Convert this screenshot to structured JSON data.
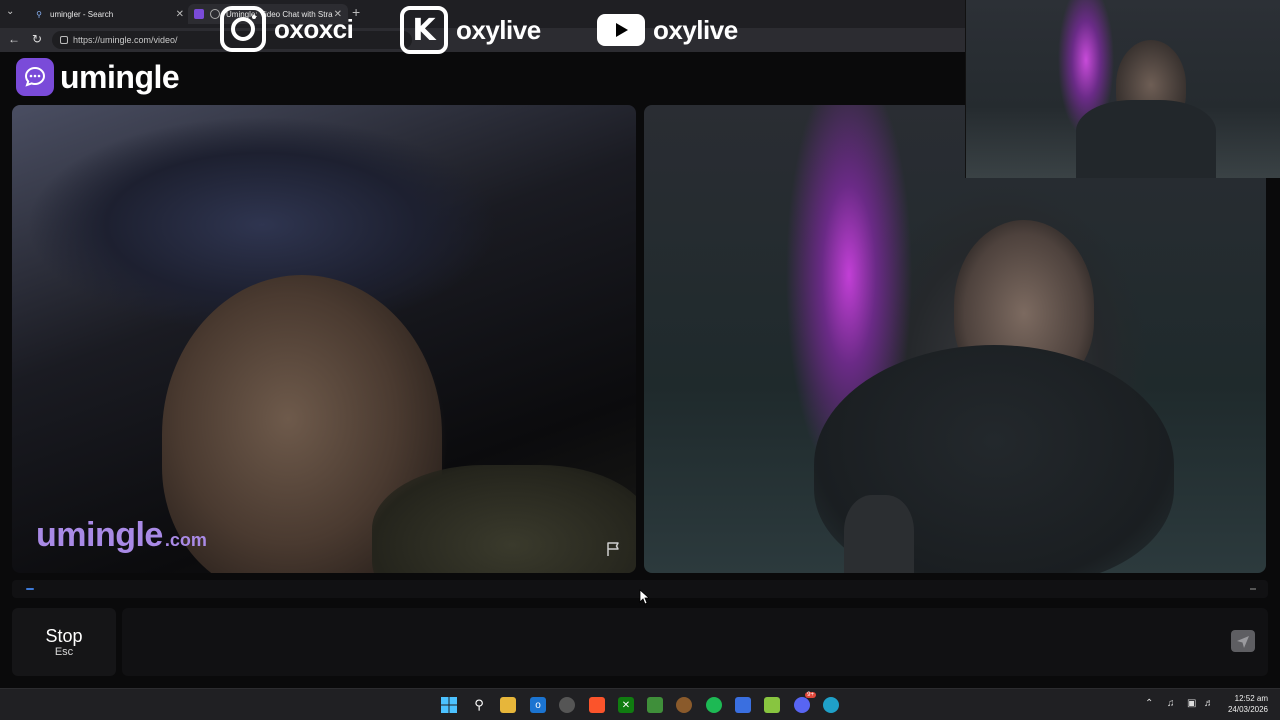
{
  "browser": {
    "tabs": [
      {
        "label": "umingler - Search",
        "active": false
      },
      {
        "label": "Umingle: Video Chat with Stra",
        "active": true
      }
    ],
    "url": "https://umingle.com/video/"
  },
  "overlay": {
    "instagram": "oxoxci",
    "kick": "oxylive",
    "youtube": "oxylive"
  },
  "app": {
    "brand": "umingle",
    "watermark_main": "umingle",
    "watermark_suffix": ".com",
    "accent_color": "#7a4bd9"
  },
  "controls": {
    "stop_label": "Stop",
    "stop_key": "Esc",
    "chat_placeholder": ""
  },
  "taskbar": {
    "time": "12:52 am",
    "date": "24/03/2026",
    "discord_badge": "9+"
  },
  "icons": [
    "search-icon",
    "flag-icon",
    "send-icon",
    "windows-start-icon",
    "folder-icon",
    "edge-icon",
    "spotify-icon",
    "discord-icon"
  ]
}
